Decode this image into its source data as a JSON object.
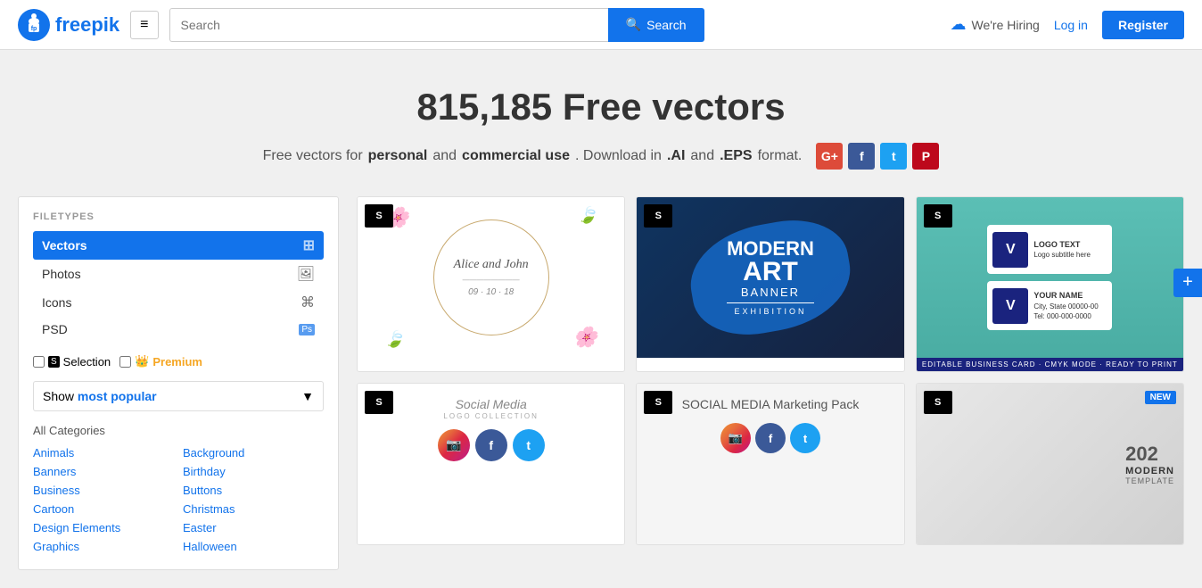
{
  "header": {
    "logo_text": "freepik",
    "menu_icon": "≡",
    "search_placeholder": "Search",
    "search_btn_label": "Search",
    "hiring_text": "We're Hiring",
    "login_label": "Log in",
    "register_label": "Register"
  },
  "hero": {
    "title": "815,185 Free vectors",
    "subtitle_pre": "Free vectors for",
    "subtitle_bold1": "personal",
    "subtitle_mid": "and",
    "subtitle_bold2": "commercial use",
    "subtitle_post": ". Download in",
    "format1": ".AI",
    "format_mid": "and",
    "format2": ".EPS",
    "format_end": "format."
  },
  "sidebar": {
    "section_title": "FILETYPES",
    "filetypes": [
      {
        "label": "Vectors",
        "active": true
      },
      {
        "label": "Photos",
        "active": false
      },
      {
        "label": "Icons",
        "active": false
      },
      {
        "label": "PSD",
        "active": false
      }
    ],
    "selection_label": "Selection",
    "premium_label": "Premium",
    "show_popular_label": "Show",
    "show_popular_value": "most popular",
    "all_categories": "All Categories",
    "categories_left": [
      "Animals",
      "Banners",
      "Business",
      "Cartoon",
      "Design Elements",
      "Graphics"
    ],
    "categories_right": [
      "Background",
      "Birthday",
      "Buttons",
      "Christmas",
      "Easter",
      "Halloween"
    ]
  },
  "cards": [
    {
      "id": 1,
      "badge": "S",
      "type": "floral",
      "title": "Alice and John",
      "subtitle": "09 · 10 · 18"
    },
    {
      "id": 2,
      "badge": "S",
      "type": "art",
      "line1": "MODERN",
      "line2": "ART",
      "line3": "BANNER",
      "line4": "EXHIBITION"
    },
    {
      "id": 3,
      "badge": "S",
      "type": "business",
      "line1": "LOGO TEXT",
      "line2": "YOUR NAME",
      "caption": "EDITABLE BUSINESS CARD · CMYK MODE · READY TO PRINT"
    },
    {
      "id": 4,
      "badge": "S",
      "type": "social_logo",
      "title": "Social Media",
      "subtitle": "LOGO COLLECTION"
    },
    {
      "id": 5,
      "badge": "S",
      "type": "marketing",
      "title": "SOCIAL MEDIA Marketing Pack"
    },
    {
      "id": 6,
      "badge": "S",
      "type": "creative",
      "new_badge": "NEW",
      "year": "202",
      "modern": "MODERN",
      "template": "TEMPLATE"
    }
  ],
  "plus_btn": "+"
}
